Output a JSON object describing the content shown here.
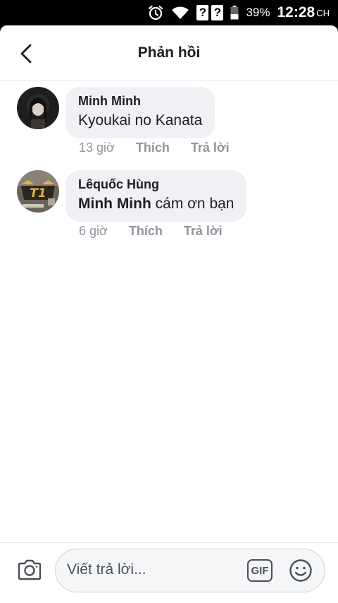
{
  "status_bar": {
    "icons": [
      "alarm-icon",
      "wifi-icon",
      "unknown-signal-icon",
      "unknown-signal-icon",
      "battery-icon"
    ],
    "sim1": "?",
    "sim2": "?",
    "battery": "39%",
    "time": "12:28",
    "ampm": "CH"
  },
  "header": {
    "title": "Phản hồi",
    "back_icon": "chevron-left-icon"
  },
  "comments": [
    {
      "author": "Minh Minh",
      "mention": "",
      "text": "Kyoukai no Kanata",
      "time": "13 giờ",
      "like_label": "Thích",
      "reply_label": "Trả lời",
      "avatar_icon": "avatar-dark-hair"
    },
    {
      "author": "Lêquốc Hùng",
      "mention": "Minh Minh",
      "text": " cám ơn bạn",
      "time": "6 giờ",
      "like_label": "Thích",
      "reply_label": "Trả lời",
      "avatar_icon": "avatar-skt-logo"
    }
  ],
  "composer": {
    "placeholder": "Viết trả lời...",
    "gif_label": "GIF",
    "camera_icon": "camera-icon",
    "emoji_icon": "smiley-icon"
  },
  "colors": {
    "bubble": "#f0f1f4",
    "meta": "#90949c",
    "text": "#1c1e21"
  }
}
